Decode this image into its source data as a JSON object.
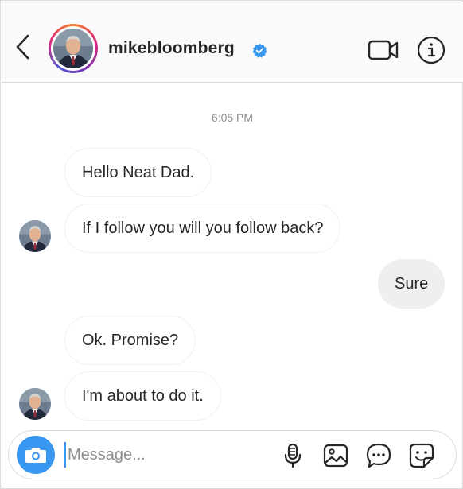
{
  "header": {
    "username": "mikebloomberg",
    "back_icon": "chevron-left-icon",
    "verified_icon": "verified-badge-icon",
    "video_icon": "video-camera-icon",
    "info_icon": "info-icon"
  },
  "thread": {
    "timestamp": "6:05 PM",
    "messages": [
      {
        "sender": "them",
        "text": "Hello Neat Dad."
      },
      {
        "sender": "them",
        "text": "If I follow you will you follow back?"
      },
      {
        "sender": "me",
        "text": "Sure"
      },
      {
        "sender": "them",
        "text": "Ok. Promise?"
      },
      {
        "sender": "them",
        "text": "I'm about to do it."
      }
    ]
  },
  "composer": {
    "placeholder": "Message...",
    "value": "",
    "icons": [
      "camera-icon",
      "microphone-icon",
      "image-icon",
      "chat-bubble-icon",
      "sticker-icon"
    ]
  },
  "colors": {
    "accent": "#3897f0",
    "verified": "#3897f0",
    "outgoing_bubble": "#efefef",
    "text": "#262626",
    "muted": "#8e8e8e",
    "border": "#dbdbdb"
  }
}
